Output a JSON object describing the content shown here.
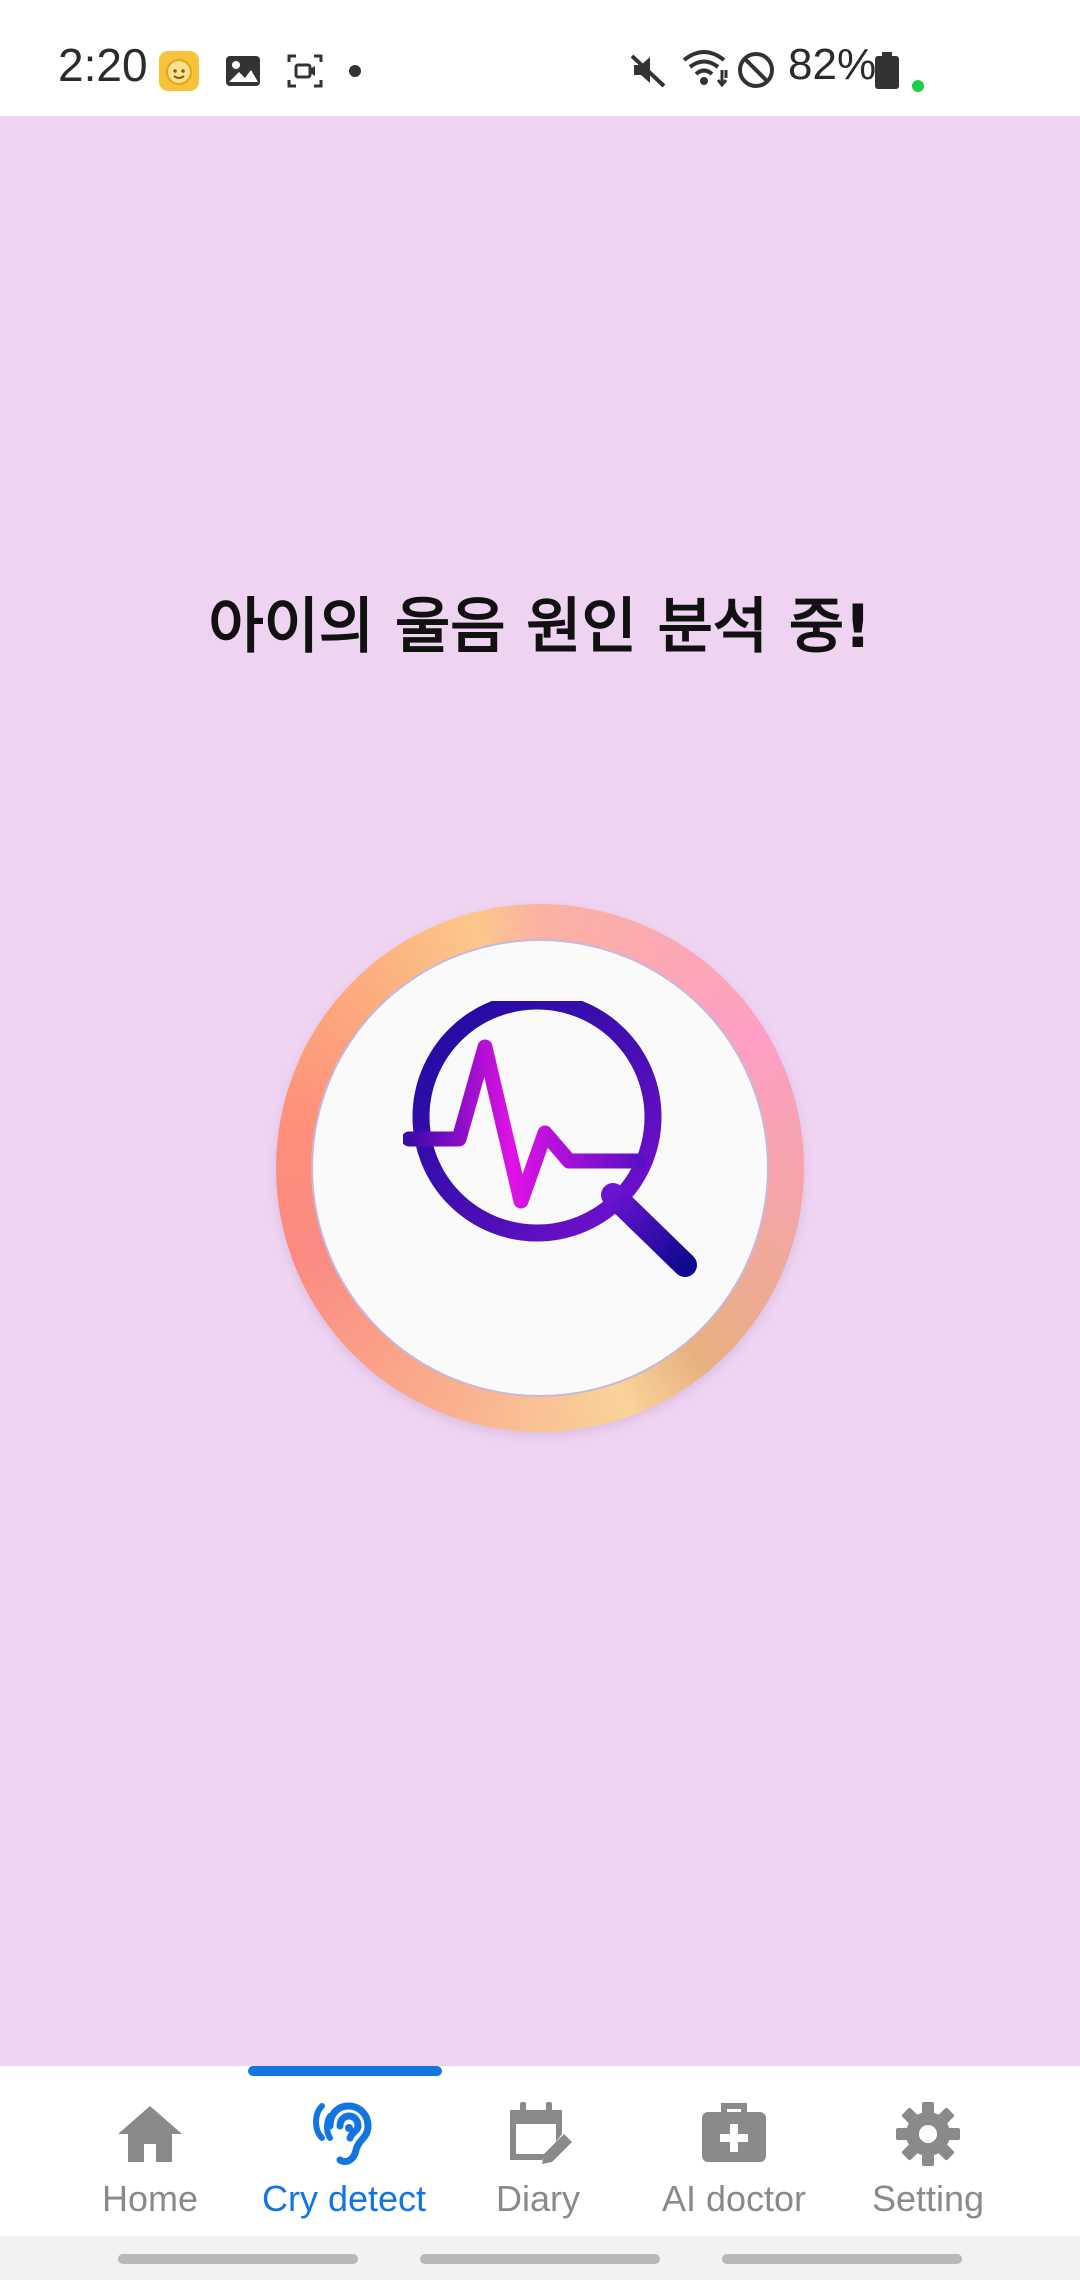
{
  "status_bar": {
    "time": "2:20",
    "battery_percent": "82%",
    "left_icons": [
      "baby-app-icon",
      "gallery-icon",
      "screen-record-icon",
      "dot-icon"
    ],
    "right_icons": [
      "mute-icon",
      "wifi-icon",
      "do-not-disturb-icon",
      "battery-icon"
    ]
  },
  "main": {
    "background": "#efd4f2",
    "headline": "아이의 울음 원인 분석 중!",
    "analysis_icon": "search-pulse-icon"
  },
  "bottom_nav": {
    "accent": "#1275e0",
    "active_index": 1,
    "items": [
      {
        "label": "Home",
        "icon": "home-icon"
      },
      {
        "label": "Cry detect",
        "icon": "ear-icon"
      },
      {
        "label": "Diary",
        "icon": "calendar-edit-icon"
      },
      {
        "label": "AI doctor",
        "icon": "medical-kit-icon"
      },
      {
        "label": "Setting",
        "icon": "gear-icon"
      }
    ]
  }
}
